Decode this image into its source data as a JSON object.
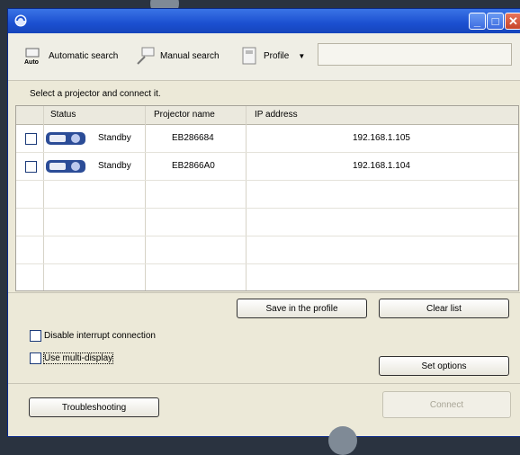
{
  "toolbar": {
    "automatic_search": "Automatic search",
    "manual_search": "Manual search",
    "profile": "Profile"
  },
  "instruction": "Select a projector and connect it.",
  "table": {
    "headers": [
      "Status",
      "Projector name",
      "IP address"
    ],
    "rows": [
      {
        "status": "Standby",
        "name": "EB286684",
        "ip": "192.168.1.105"
      },
      {
        "status": "Standby",
        "name": "EB2866A0",
        "ip": "192.168.1.104"
      }
    ]
  },
  "buttons": {
    "save_profile": "Save in the profile",
    "clear_list": "Clear list",
    "set_options": "Set options",
    "troubleshooting": "Troubleshooting",
    "connect": "Connect"
  },
  "options": {
    "disable_interrupt": "Disable interrupt connection",
    "multi_display": "Use multi-display"
  },
  "colors": {
    "titlebar": "#1b4fd0",
    "window_bg": "#ece9d8",
    "page_bg": "#2a3340"
  }
}
